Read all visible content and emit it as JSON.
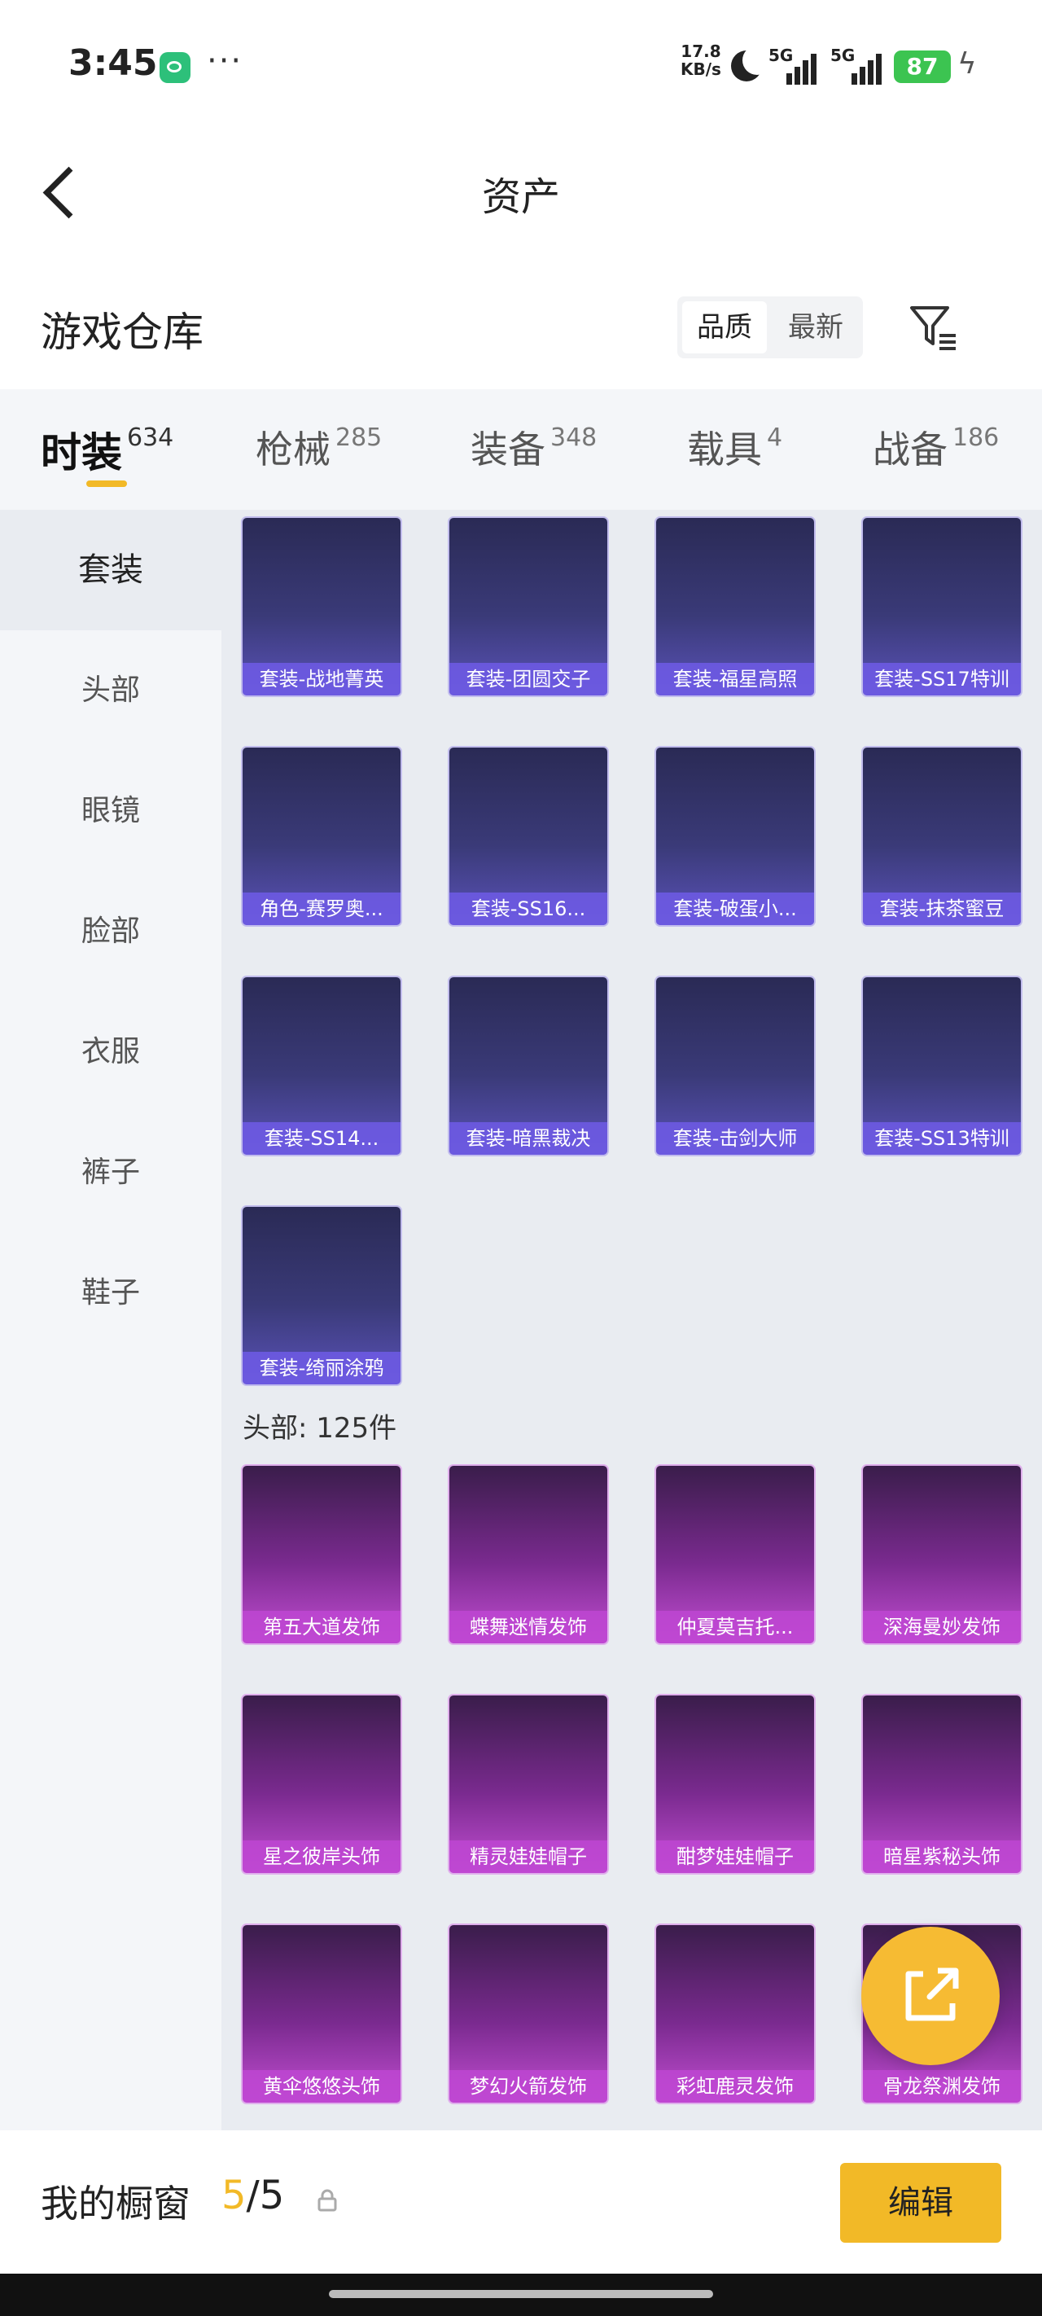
{
  "status_bar": {
    "time": "3:45",
    "speed_value": "17.8",
    "speed_unit": "KB/s",
    "net1": "5G",
    "net2": "5G",
    "battery": "87"
  },
  "nav": {
    "title": "资产",
    "back_icon": "back-arrow-icon"
  },
  "warehouse": {
    "title": "游戏仓库",
    "sort_options": [
      "品质",
      "最新"
    ],
    "sort_selected": "品质",
    "filter_icon": "filter-icon"
  },
  "tabs": [
    {
      "label": "时装",
      "count": "634",
      "active": true
    },
    {
      "label": "枪械",
      "count": "285"
    },
    {
      "label": "装备",
      "count": "348"
    },
    {
      "label": "载具",
      "count": "4"
    },
    {
      "label": "战备",
      "count": "186"
    }
  ],
  "sidebar": {
    "items": [
      "套装",
      "头部",
      "眼镜",
      "脸部",
      "衣服",
      "裤子",
      "鞋子"
    ],
    "active": "套装"
  },
  "suits": [
    "套装-战地菁英",
    "套装-团圆交子",
    "套装-福星高照",
    "套装-SS17特训",
    "角色-赛罗奥...",
    "套装-SS16...",
    "套装-破蛋小...",
    "套装-抹茶蜜豆",
    "套装-SS14...",
    "套装-暗黑裁决",
    "套装-击剑大师",
    "套装-SS13特训",
    "套装-绮丽涂鸦"
  ],
  "head_section": {
    "label": "头部: 125件"
  },
  "heads": [
    "第五大道发饰",
    "蝶舞迷情发饰",
    "仲夏莫吉托...",
    "深海曼妙发饰",
    "星之彼岸头饰",
    "精灵娃娃帽子",
    "酣梦娃娃帽子",
    "暗星紫秘头饰",
    "黄伞悠悠头饰",
    "梦幻火箭发饰",
    "彩虹鹿灵发饰",
    "骨龙祭渊发饰"
  ],
  "bottom": {
    "title": "我的橱窗",
    "current": "5",
    "separator": "/",
    "total": "5",
    "edit_label": "编辑"
  },
  "colors": {
    "accent": "#f2b927",
    "suit_card": "#3a3a78",
    "head_card": "#7a2a8f"
  }
}
